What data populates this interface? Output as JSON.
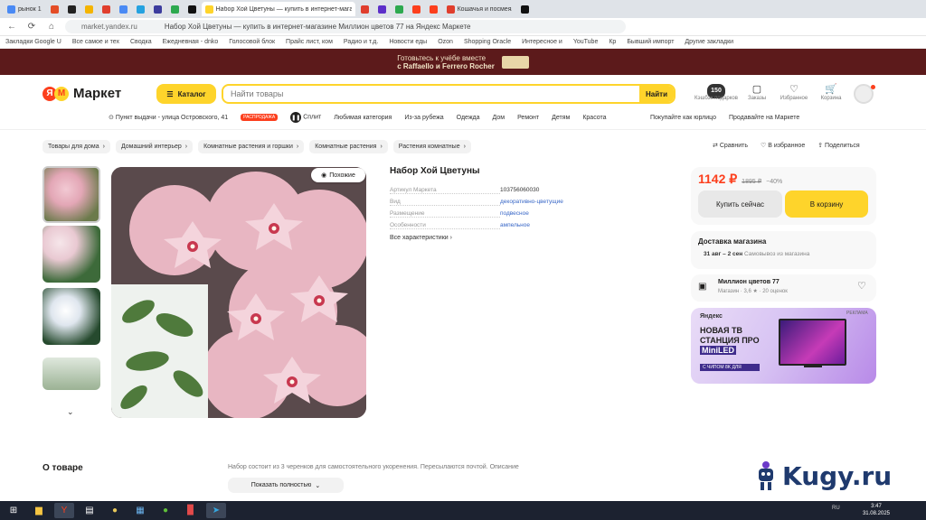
{
  "browser": {
    "tabs": [
      {
        "label": "рынок 1",
        "color": "#4a8af4"
      },
      {
        "label": "",
        "color": "#e44d26"
      },
      {
        "label": "",
        "color": "#222"
      },
      {
        "label": "",
        "color": "#f4b400"
      },
      {
        "label": "",
        "color": "#e03e2d"
      },
      {
        "label": "",
        "color": "#4a8af4"
      },
      {
        "label": "",
        "color": "#25a2e0"
      },
      {
        "label": "",
        "color": "#3c3c9e"
      },
      {
        "label": "",
        "color": "#2da94f"
      },
      {
        "label": "",
        "color": "#111"
      },
      {
        "label": "Набор Хой Цветуны — купить в интернет-магазине Миллион цветов 77 на Яндекс Маркете",
        "color": "#fed42b",
        "active": true
      },
      {
        "label": "",
        "color": "#e03e2d"
      },
      {
        "label": "",
        "color": "#5c2fc9"
      },
      {
        "label": "",
        "color": "#2da94f"
      },
      {
        "label": "",
        "color": "#fc3f1d"
      },
      {
        "label": "",
        "color": "#fc3f1d"
      },
      {
        "label": "Кошачья и посмеялась",
        "color": "#e03e2d"
      },
      {
        "label": "",
        "color": "#111"
      }
    ],
    "url": "market.yandex.ru",
    "page_title": "Набор Хой Цветуны — купить в интернет-магазине Миллион цветов 77 на Яндекс Маркете",
    "bookmarks": [
      "Закладки Google U",
      "Все самое и тех",
      "Сводка",
      "Ежедневная - dnko",
      "Голосовой блок",
      "Прайс лист, ком",
      "Радио и т.д.",
      "Новости еды",
      "Ozon",
      "Shopping Oracle",
      "Интересное и",
      "YouTube",
      "Кр",
      "Бывший импорт",
      "Другие закладки"
    ]
  },
  "promo": {
    "line1": "Готовьтесь к учёбе вместе",
    "line2": "с Raffaello и Ferrero Rocher"
  },
  "header": {
    "logo_text": "Маркет",
    "logo_letter_y": "Я",
    "logo_letter_m": "М",
    "catalog_label": "Каталог",
    "search_placeholder": "Найти товары",
    "search_button": "Найти",
    "coins_value": "150",
    "coins_label": "Кэшбэк подарков",
    "orders_label": "Заказы",
    "favorites_label": "Избранное",
    "cart_label": "Корзина"
  },
  "subnav": {
    "pickup": "Пункт выдачи - улица Островского, 41",
    "badge": "РАСПРОДАЖА",
    "split": "Сплит",
    "items": [
      "Любимая категория",
      "Из-за рубежа",
      "Одежда",
      "Дом",
      "Ремонт",
      "Детям",
      "Красота"
    ],
    "right": [
      "Покупайте как юрлицо",
      "Продавайте на Маркете"
    ]
  },
  "breadcrumbs": [
    "Товары для дома",
    "Домашний интерьер",
    "Комнатные растения и горшки",
    "Комнатные растения",
    "Растения комнатные"
  ],
  "page_actions": [
    "Сравнить",
    "В избранное",
    "Поделиться"
  ],
  "gallery": {
    "zoom_label": "Похожие"
  },
  "product": {
    "title": "Набор Хой Цветуны",
    "specs": [
      {
        "key": "Артикул Маркета",
        "value": "103756060030",
        "link": false
      },
      {
        "key": "Вид",
        "value": "декоративно-цветущие",
        "link": true
      },
      {
        "key": "Размещение",
        "value": "подвесное",
        "link": true
      },
      {
        "key": "Особенности",
        "value": "ампельное",
        "link": true
      }
    ],
    "all_specs": "Все характеристики"
  },
  "buy": {
    "price": "1142 ₽",
    "old_price": "1895 ₽",
    "discount": "−40%",
    "buy_now": "Купить сейчас",
    "to_cart": "В корзину"
  },
  "delivery": {
    "title": "Доставка магазина",
    "date": "31 авг – 2 сен",
    "note": "Самовывоз из магазина"
  },
  "shop": {
    "name": "Миллион цветов 77",
    "rating": "Магазин · 3,6 ★ · 20 оценок"
  },
  "ad": {
    "brand": "Яндекс",
    "headline": "НОВАЯ ТВ СТАНЦИЯ ПРО",
    "mini": "MiniLED",
    "promo": "С ЧИПОМ 8K ДЛЯ",
    "tag": "РЕКЛАМА"
  },
  "about": {
    "title": "О товаре",
    "desc": "Набор состоит из 3 черенков для самостоятельного укоренения. Пересылаются почтой. Описание",
    "show_all": "Показать полностью"
  },
  "watermark": "Kugy.ru",
  "taskbar": {
    "time": "3:47",
    "date": "31.08.2025",
    "lang": "RU"
  }
}
